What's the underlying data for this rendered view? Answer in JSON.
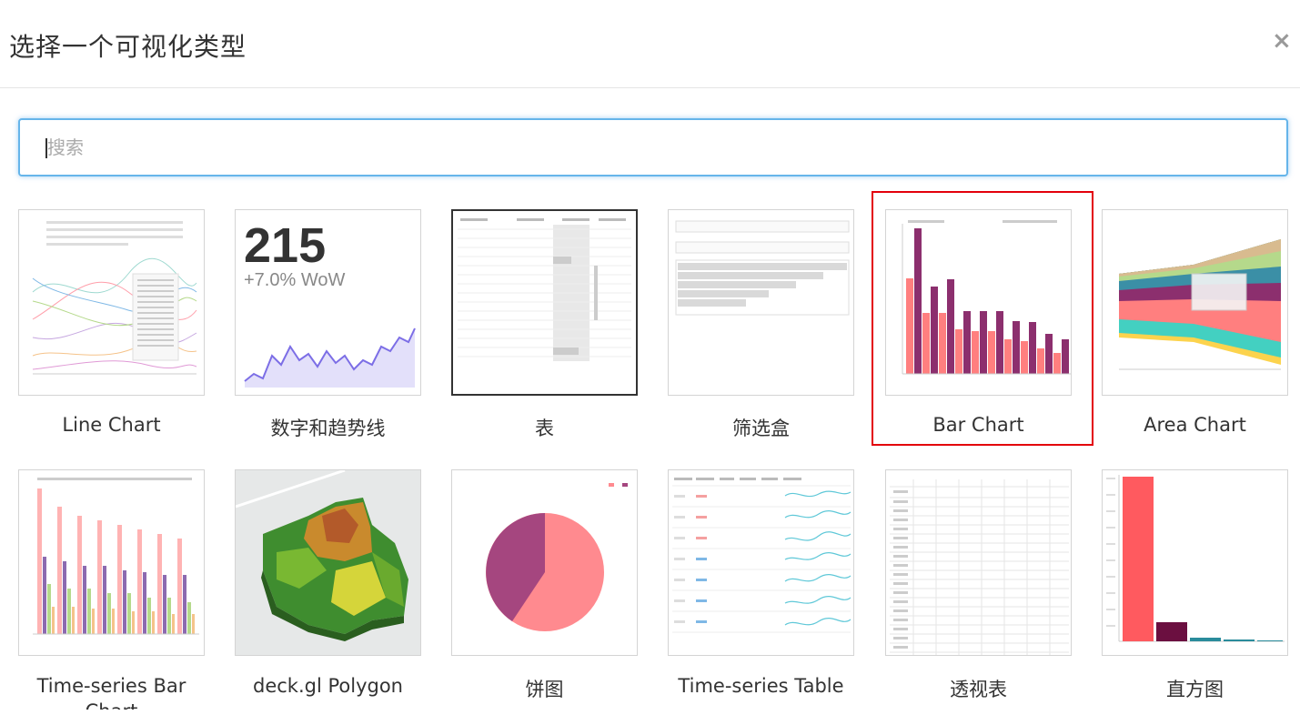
{
  "dialog": {
    "title": "选择一个可视化类型",
    "close_symbol": "×"
  },
  "search": {
    "placeholder": "搜索",
    "value": ""
  },
  "selected_type": "Bar Chart",
  "colors": {
    "accent_border": "#66b5ea",
    "selection": "#e3000b",
    "bar_pink": "#ff7f7f",
    "bar_purple": "#8c2f6e"
  },
  "visualizations": [
    {
      "label": "Line Chart",
      "icon": "line-chart-thumbnail"
    },
    {
      "label": "数字和趋势线",
      "icon": "big-number-trendline-thumbnail",
      "number": "215",
      "change": "+7.0% WoW"
    },
    {
      "label": "表",
      "icon": "table-thumbnail"
    },
    {
      "label": "筛选盒",
      "icon": "filter-box-thumbnail"
    },
    {
      "label": "Bar Chart",
      "icon": "bar-chart-thumbnail"
    },
    {
      "label": "Area Chart",
      "icon": "area-chart-thumbnail"
    },
    {
      "label": "Time-series Bar Chart",
      "icon": "time-series-bar-thumbnail"
    },
    {
      "label": "deck.gl Polygon",
      "icon": "deckgl-polygon-map-thumbnail"
    },
    {
      "label": "饼图",
      "icon": "pie-chart-thumbnail"
    },
    {
      "label": "Time-series Table",
      "icon": "time-series-table-thumbnail"
    },
    {
      "label": "透视表",
      "icon": "pivot-table-thumbnail"
    },
    {
      "label": "直方图",
      "icon": "histogram-thumbnail"
    }
  ]
}
